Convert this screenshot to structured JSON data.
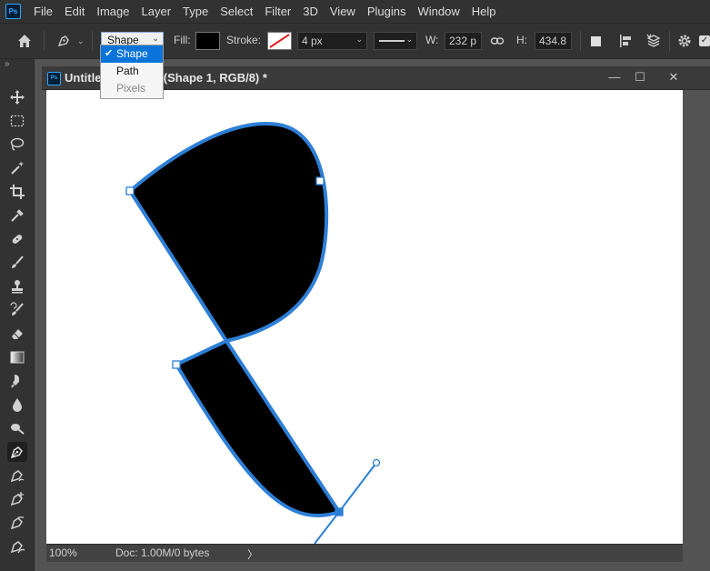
{
  "app": {
    "logo_text": "Ps"
  },
  "menu": [
    "File",
    "Edit",
    "Image",
    "Layer",
    "Type",
    "Select",
    "Filter",
    "3D",
    "View",
    "Plugins",
    "Window",
    "Help"
  ],
  "options_bar": {
    "mode_value": "Shape",
    "mode_options": [
      {
        "label": "Shape",
        "selected": true,
        "disabled": false
      },
      {
        "label": "Path",
        "selected": false,
        "disabled": false
      },
      {
        "label": "Pixels",
        "selected": false,
        "disabled": true
      }
    ],
    "fill_label": "Fill:",
    "fill_color": "#000000",
    "stroke_label": "Stroke:",
    "stroke_width": "4 px",
    "w_label": "W:",
    "w_value": "232 p",
    "h_label": "H:",
    "h_value": "434.8",
    "link_icon": "link-icon",
    "checkbox_checked": true
  },
  "document": {
    "tab_title": "Untitled-1 @ 100% (Shape 1, RGB/8) *",
    "tab_title_visible_start": "Untitle",
    "tab_title_visible_end": "% (Shape 1, RGB/8) *",
    "minimize": "—",
    "restore": "☐",
    "close": "✕"
  },
  "status": {
    "zoom": "100%",
    "doc_info": "Doc: 1.00M/0 bytes",
    "arrow": "〉"
  },
  "colors": {
    "shape_fill": "#000000",
    "path_stroke": "#2d7fd6",
    "accent": "#31a8ff"
  }
}
